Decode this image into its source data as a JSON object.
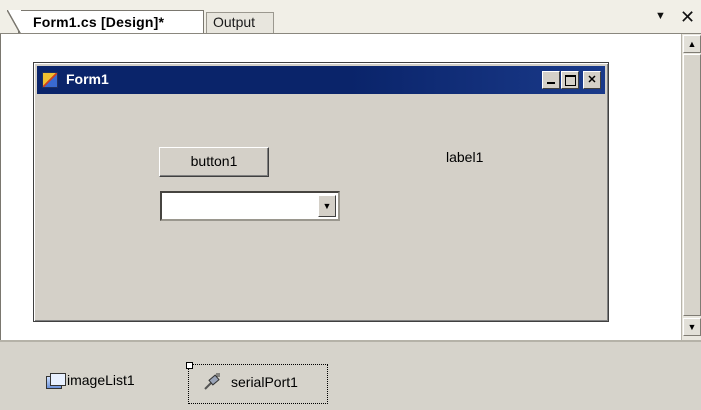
{
  "tabs": [
    {
      "label": "Form1.cs [Design]*"
    },
    {
      "label": "Output"
    }
  ],
  "tab_controls": {
    "dropdown_glyph": "▼",
    "close_glyph": "✕"
  },
  "form": {
    "title": "Form1",
    "caption_buttons": {
      "minimize": "",
      "maximize": "",
      "close": "✕"
    },
    "button1": "button1",
    "combobox_value": "",
    "label1": "label1"
  },
  "tray": {
    "items": [
      {
        "label": "imageList1",
        "icon": "imagelist-icon"
      },
      {
        "label": "serialPort1",
        "icon": "serial-port-icon"
      }
    ]
  },
  "colors": {
    "titlebar": "#0a246a",
    "form_face": "#d4d0c8",
    "tray": "#d6d3cb"
  }
}
